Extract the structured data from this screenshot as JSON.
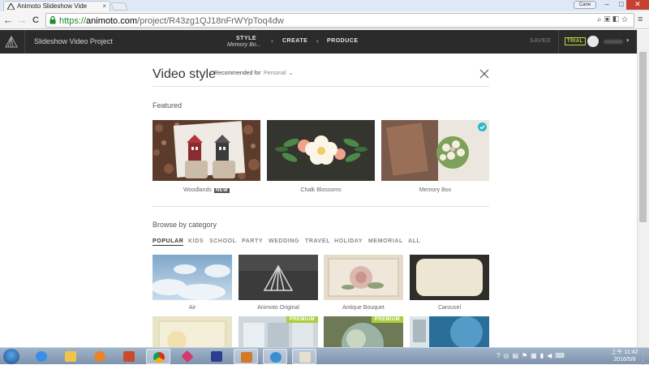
{
  "browser": {
    "tab_title": "Animoto Slideshow Vide",
    "tab_close": "×",
    "user_chip": "Cane",
    "url_scheme": "https://",
    "url_domain": "animoto.com",
    "url_path": "/project/R43zg1QJ18nFrWYpToq4dw",
    "back": "←",
    "forward": "→",
    "reload": "C",
    "menu": "≡",
    "min": "–",
    "max": "□",
    "close": "✕"
  },
  "app": {
    "project_title": "Slideshow Video Project",
    "steps": [
      {
        "label": "STYLE",
        "sub": "Memory Bo..."
      },
      {
        "label": "CREATE"
      },
      {
        "label": "PRODUCE"
      }
    ],
    "arrow": "›",
    "saved": "SAVED",
    "trial": "TRIAL",
    "user_caret": "▾"
  },
  "modal": {
    "title": "Video style",
    "recommended_label": "Recommended for",
    "recommended_value": "Personal",
    "recommended_caret": "⌄",
    "featured_label": "Featured",
    "featured": [
      {
        "name": "Woodlands",
        "badge": "NEW"
      },
      {
        "name": "Chalk Blossoms",
        "badge": ""
      },
      {
        "name": "Memory Box",
        "badge": "",
        "selected": true
      }
    ],
    "browse_label": "Browse by category",
    "categories": [
      "POPULAR",
      "KIDS",
      "SCHOOL",
      "PARTY",
      "WEDDING",
      "TRAVEL",
      "HOLIDAY",
      "MEMORIAL",
      "ALL"
    ],
    "active_category": "POPULAR",
    "styles": [
      {
        "name": "Air"
      },
      {
        "name": "Animoto Original"
      },
      {
        "name": "Antique Bouquet"
      },
      {
        "name": "Carousel"
      }
    ],
    "premium_label": "PREMIUM"
  },
  "taskbar": {
    "time": "上午 11:42",
    "date": "2016/5/8"
  },
  "colors": {
    "appbar": "#2b2b2b",
    "trial_accent": "#b9d936",
    "premium": "#a9cf3a",
    "selected_check": "#2ab8c9"
  }
}
